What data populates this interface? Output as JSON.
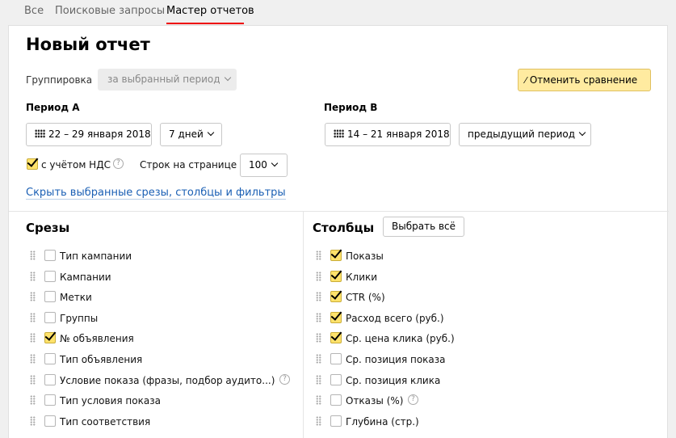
{
  "tabs": [
    "Все",
    "Поисковые запросы",
    "Мастер отчетов"
  ],
  "active_tab": 2,
  "title": "Новый отчет",
  "grouping": {
    "label": "Группировка",
    "value": "за выбранный период"
  },
  "cancel_compare": "Отменить сравнение",
  "period_a": {
    "label": "Период А",
    "dates": "22 – 29 января 2018",
    "range": "7 дней"
  },
  "period_b": {
    "label": "Период В",
    "dates": "14 – 21 января 2018",
    "range": "предыдущий период"
  },
  "vat": {
    "label": "с учётом НДС",
    "checked": true
  },
  "rows_per_page": {
    "label": "Строк на странице",
    "value": "100"
  },
  "hide_link": "Скрыть выбранные срезы, столбцы и фильтры",
  "help_glyph": "?",
  "slices": {
    "title": "Срезы",
    "items": [
      {
        "label": "Тип кампании",
        "checked": false,
        "help": false
      },
      {
        "label": "Кампании",
        "checked": false,
        "help": false
      },
      {
        "label": "Метки",
        "checked": false,
        "help": false
      },
      {
        "label": "Группы",
        "checked": false,
        "help": false
      },
      {
        "label": "№ объявления",
        "checked": true,
        "help": false
      },
      {
        "label": "Тип объявления",
        "checked": false,
        "help": false
      },
      {
        "label": "Условие показа (фразы, подбор аудито...)",
        "checked": false,
        "help": true
      },
      {
        "label": "Тип условия показа",
        "checked": false,
        "help": false
      },
      {
        "label": "Тип соответствия",
        "checked": false,
        "help": false
      }
    ]
  },
  "columns": {
    "title": "Столбцы",
    "select_all": "Выбрать всё",
    "items": [
      {
        "label": "Показы",
        "checked": true,
        "help": false
      },
      {
        "label": "Клики",
        "checked": true,
        "help": false
      },
      {
        "label": "CTR (%)",
        "checked": true,
        "help": false
      },
      {
        "label": "Расход всего (руб.)",
        "checked": true,
        "help": false
      },
      {
        "label": "Ср. цена клика (руб.)",
        "checked": true,
        "help": false
      },
      {
        "label": "Ср. позиция показа",
        "checked": false,
        "help": false
      },
      {
        "label": "Ср. позиция клика",
        "checked": false,
        "help": false
      },
      {
        "label": "Отказы (%)",
        "checked": false,
        "help": true
      },
      {
        "label": "Глубина (стр.)",
        "checked": false,
        "help": false
      }
    ]
  }
}
